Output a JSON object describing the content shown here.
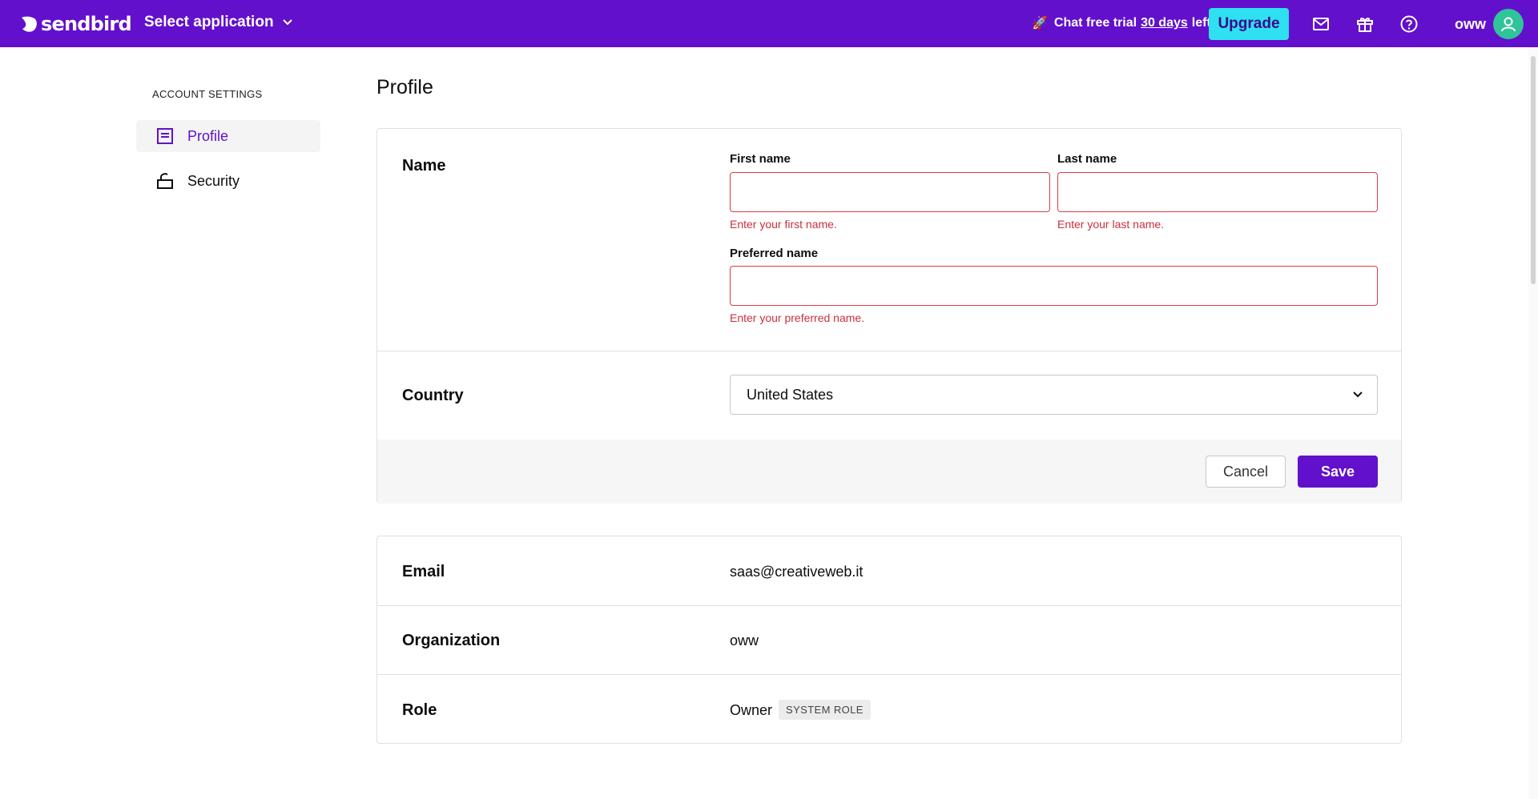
{
  "topbar": {
    "brand": "sendbird",
    "app_select": "Select application",
    "trial_prefix": "Chat free trial",
    "trial_days": "30 days",
    "trial_suffix": "left",
    "upgrade": "Upgrade",
    "user": "oww",
    "icons": [
      "mail-icon",
      "gift-icon",
      "help-icon",
      "user-avatar-icon"
    ],
    "colors": {
      "bar": "#6210cc",
      "upgrade": "#2ee0f0",
      "avatar": "#30c49a"
    }
  },
  "sidebar": {
    "title": "ACCOUNT SETTINGS",
    "items": [
      {
        "label": "Profile",
        "icon": "profile-icon",
        "active": true
      },
      {
        "label": "Security",
        "icon": "lock-icon",
        "active": false
      }
    ]
  },
  "main": {
    "title": "Profile",
    "name_section": {
      "label": "Name",
      "first_name": {
        "label": "First name",
        "value": "",
        "error": "Enter your first name."
      },
      "last_name": {
        "label": "Last name",
        "value": "",
        "error": "Enter your last name."
      },
      "preferred_name": {
        "label": "Preferred name",
        "value": "",
        "error": "Enter your preferred name."
      }
    },
    "country_section": {
      "label": "Country",
      "selected": "United States"
    },
    "actions": {
      "cancel": "Cancel",
      "save": "Save"
    },
    "info": {
      "email": {
        "label": "Email",
        "value": "saas@creativeweb.it"
      },
      "organization": {
        "label": "Organization",
        "value": "oww"
      },
      "role": {
        "label": "Role",
        "value": "Owner",
        "badge": "SYSTEM ROLE"
      }
    },
    "colors": {
      "accent": "#6210cc",
      "error": "#c9313d",
      "error_border": "#de3b46"
    }
  }
}
